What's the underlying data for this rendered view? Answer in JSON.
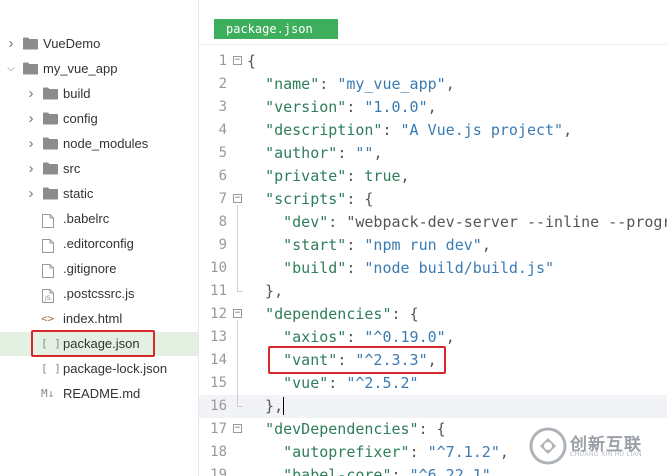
{
  "sidebar": {
    "items": [
      {
        "label": "VueDemo",
        "kind": "folder",
        "expanded": false
      },
      {
        "label": "my_vue_app",
        "kind": "folder",
        "expanded": true
      },
      {
        "label": "build",
        "kind": "folder",
        "expanded": false
      },
      {
        "label": "config",
        "kind": "folder",
        "expanded": false
      },
      {
        "label": "node_modules",
        "kind": "folder",
        "expanded": false
      },
      {
        "label": "src",
        "kind": "folder",
        "expanded": false
      },
      {
        "label": "static",
        "kind": "folder",
        "expanded": false
      },
      {
        "label": ".babelrc",
        "kind": "file",
        "icon": "file-icon"
      },
      {
        "label": ".editorconfig",
        "kind": "file",
        "icon": "file-icon"
      },
      {
        "label": ".gitignore",
        "kind": "file",
        "icon": "file-icon"
      },
      {
        "label": ".postcssrc.js",
        "kind": "file",
        "icon": "js-file-icon"
      },
      {
        "label": "index.html",
        "kind": "file",
        "icon": "html-file-icon",
        "glyph": "<>"
      },
      {
        "label": "package.json",
        "kind": "file",
        "icon": "json-file-icon",
        "glyph": "[ ]",
        "selected": true
      },
      {
        "label": "package-lock.json",
        "kind": "file",
        "icon": "json-file-icon",
        "glyph": "[ ]"
      },
      {
        "label": "README.md",
        "kind": "file",
        "icon": "markdown-file-icon",
        "glyph": "M↓"
      }
    ]
  },
  "editor": {
    "tab_label": "package.json",
    "lines": [
      {
        "n": "1",
        "text": "{"
      },
      {
        "n": "2",
        "text": "  \"name\": \"my_vue_app\","
      },
      {
        "n": "3",
        "text": "  \"version\": \"1.0.0\","
      },
      {
        "n": "4",
        "text": "  \"description\": \"A Vue.js project\","
      },
      {
        "n": "5",
        "text": "  \"author\": \"\","
      },
      {
        "n": "6",
        "text": "  \"private\": true,"
      },
      {
        "n": "7",
        "text": "  \"scripts\": {"
      },
      {
        "n": "8",
        "text": "    \"dev\": \"webpack-dev-server --inline --progr"
      },
      {
        "n": "9",
        "text": "    \"start\": \"npm run dev\","
      },
      {
        "n": "10",
        "text": "    \"build\": \"node build/build.js\""
      },
      {
        "n": "11",
        "text": "  },"
      },
      {
        "n": "12",
        "text": "  \"dependencies\": {"
      },
      {
        "n": "13",
        "text": "    \"axios\": \"^0.19.0\","
      },
      {
        "n": "14",
        "text": "    \"vant\": \"^2.3.3\","
      },
      {
        "n": "15",
        "text": "    \"vue\": \"^2.5.2\""
      },
      {
        "n": "16",
        "text": "  },"
      },
      {
        "n": "17",
        "text": "  \"devDependencies\": {"
      },
      {
        "n": "18",
        "text": "    \"autoprefixer\": \"^7.1.2\","
      },
      {
        "n": "19",
        "text": "    \"babel-core\": \"^6.22.1\","
      }
    ]
  },
  "watermark": {
    "text": "创新互联",
    "subtext": "CHUANG XIN HU LIAN"
  },
  "colors": {
    "tab": "#3cae5c",
    "highlight_box": "#d9272e",
    "key": "#2e7d5b",
    "string": "#3a7bb2"
  }
}
